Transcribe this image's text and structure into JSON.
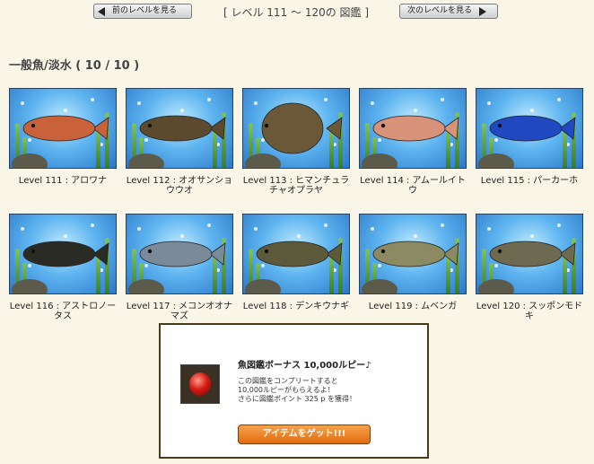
{
  "nav": {
    "prev_label": "前のレベルを見る",
    "next_label": "次のレベルを見る",
    "range_title": "[ レベル 111 〜 120の 図鑑 ]"
  },
  "section": {
    "title": "一般魚/淡水 ( 10 / 10 )"
  },
  "fish": [
    {
      "caption": "Level 111 : アロワナ",
      "body_color": "#c9623a"
    },
    {
      "caption": "Level 112 : オオサンショウウオ",
      "body_color": "#5b4a2e"
    },
    {
      "caption": "Level 113 : ヒマンチュラチャオプラヤ",
      "body_color": "#6b5838"
    },
    {
      "caption": "Level 114 : アムールイトウ",
      "body_color": "#d8927a"
    },
    {
      "caption": "Level 115 : パーカーホ",
      "body_color": "#2048c0"
    },
    {
      "caption": "Level 116 : アストロノータス",
      "body_color": "#2b2b26"
    },
    {
      "caption": "Level 117 : メコンオオナマズ",
      "body_color": "#7a8a99"
    },
    {
      "caption": "Level 118 : デンキウナギ",
      "body_color": "#5c5a3a"
    },
    {
      "caption": "Level 119 : ムベンガ",
      "body_color": "#8c8a62"
    },
    {
      "caption": "Level 120 : スッポンモドキ",
      "body_color": "#6e6a52"
    }
  ],
  "bonus": {
    "title": "魚図鑑ボーナス 10,000ルピー♪",
    "desc": [
      "この図鑑をコンプリートすると",
      "10,000ルピーがもらえるよ！",
      "さらに図鑑ポイント 325 p を獲得！"
    ],
    "button_label": "アイテムをゲット!!!"
  },
  "colors": {
    "accent": "#e06c10",
    "water": "#5eb4ef",
    "frame": "#4a3a16"
  }
}
